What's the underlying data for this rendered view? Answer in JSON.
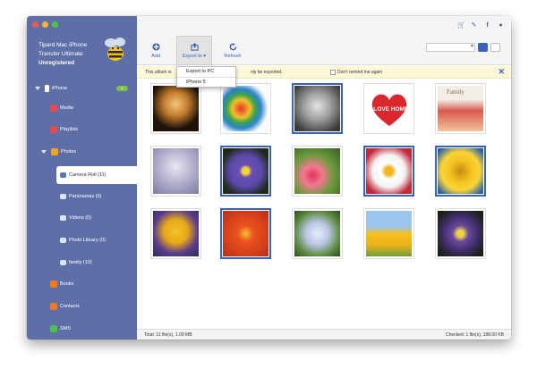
{
  "app": {
    "name_line1": "Tipard Mac iPhone",
    "name_line2": "Transfer Ultimate",
    "registration": "Unregistered"
  },
  "sidebar": {
    "device": {
      "label": "iPhone",
      "badge": "5"
    },
    "items": [
      {
        "label": "Media",
        "icon": "music-icon",
        "color": "#e34c4c"
      },
      {
        "label": "Playlists",
        "icon": "playlist-icon",
        "color": "#e34c4c"
      },
      {
        "label": "Photos",
        "icon": "photos-icon",
        "color": "#f1a41e"
      },
      {
        "label": "Camera Roll (11)",
        "icon": "camera-roll-icon",
        "color": "#5b77b8"
      },
      {
        "label": "Panoramas (0)",
        "icon": "panorama-icon",
        "color": "#5b77b8"
      },
      {
        "label": "Videos (0)",
        "icon": "video-icon",
        "color": "#5b77b8"
      },
      {
        "label": "Photo Library (0)",
        "icon": "photo-library-icon",
        "color": "#5b77b8"
      },
      {
        "label": "family (10)",
        "icon": "album-icon",
        "color": "#5b77b8"
      },
      {
        "label": "Books",
        "icon": "books-icon",
        "color": "#f07a1e"
      },
      {
        "label": "Contacts",
        "icon": "contacts-icon",
        "color": "#f07a1e"
      },
      {
        "label": "SMS",
        "icon": "sms-icon",
        "color": "#4cc04a"
      }
    ]
  },
  "toolbar": {
    "add_label": "Add",
    "export_label": "Export to",
    "refresh_label": "Refresh"
  },
  "export_menu": {
    "items": [
      "Export to PC",
      "iPhone 5"
    ]
  },
  "notice": {
    "text_prefix": "This album is",
    "text_suffix": "nly be exported.",
    "checkbox_label": "Don't remind me again"
  },
  "photos": [
    {
      "name": "silhouette-photo",
      "selected": false
    },
    {
      "name": "paint-splash-photo",
      "selected": false
    },
    {
      "name": "family-photo",
      "selected": true
    },
    {
      "name": "i-love-home-photo",
      "selected": false,
      "caption": "I LOVE HOME"
    },
    {
      "name": "family-collage-photo",
      "selected": false,
      "caption": "Family"
    },
    {
      "name": "blossom-tree-photo",
      "selected": false
    },
    {
      "name": "purple-flower-photo",
      "selected": true
    },
    {
      "name": "red-flowers-photo",
      "selected": false
    },
    {
      "name": "daisy-photo",
      "selected": true
    },
    {
      "name": "yellow-flower-photo",
      "selected": true
    },
    {
      "name": "yellow-iris-photo",
      "selected": false
    },
    {
      "name": "orange-flower-photo",
      "selected": true
    },
    {
      "name": "hydrangea-photo",
      "selected": false
    },
    {
      "name": "tulips-photo",
      "selected": false
    },
    {
      "name": "purple-flower-2-photo",
      "selected": false
    }
  ],
  "status": {
    "left": "Total: 11 file(s), 1.09 MB",
    "right": "Checked: 1 file(s), 188.00 KB"
  },
  "colors": {
    "sidebar": "#5e6fa8",
    "accent": "#3a62b7",
    "notice_bg": "#fdf8d8"
  }
}
